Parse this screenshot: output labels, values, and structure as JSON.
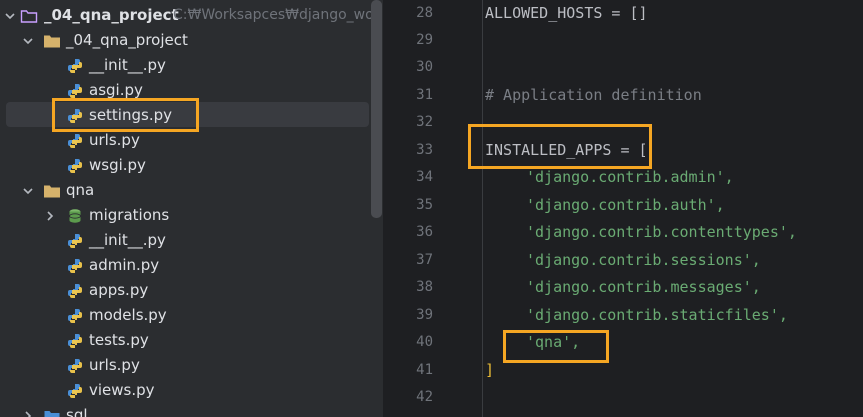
{
  "colors": {
    "accent_highlight": "#f5a623",
    "tree_bg": "#2b2d30",
    "editor_bg": "#1e1f22",
    "string": "#6aab73",
    "comment": "#7a7e85",
    "bracket": "#e8ba36"
  },
  "tree": {
    "root": {
      "label": "_04_qna_project",
      "path": "C:₩Worksapces₩django_wor",
      "icon": "module-folder-icon"
    },
    "items": [
      {
        "label": "_04_qna_project",
        "icon": "package-folder-icon",
        "expanded": true
      },
      {
        "label": "__init__.py",
        "icon": "python-file-icon"
      },
      {
        "label": "asgi.py",
        "icon": "python-file-icon"
      },
      {
        "label": "settings.py",
        "icon": "python-file-icon",
        "selected": true
      },
      {
        "label": "urls.py",
        "icon": "python-file-icon"
      },
      {
        "label": "wsgi.py",
        "icon": "python-file-icon"
      },
      {
        "label": "qna",
        "icon": "package-folder-icon",
        "expanded": true
      },
      {
        "label": "migrations",
        "icon": "database-folder-icon",
        "expanded": false
      },
      {
        "label": "__init__.py",
        "icon": "python-file-icon"
      },
      {
        "label": "admin.py",
        "icon": "python-file-icon"
      },
      {
        "label": "apps.py",
        "icon": "python-file-icon"
      },
      {
        "label": "models.py",
        "icon": "python-file-icon"
      },
      {
        "label": "tests.py",
        "icon": "python-file-icon"
      },
      {
        "label": "urls.py",
        "icon": "python-file-icon"
      },
      {
        "label": "views.py",
        "icon": "python-file-icon"
      },
      {
        "label": "sql",
        "icon": "sql-folder-icon",
        "expanded": false
      }
    ]
  },
  "editor": {
    "lines": [
      {
        "num": "28",
        "text": "ALLOWED_HOSTS = []"
      },
      {
        "num": "29",
        "text": ""
      },
      {
        "num": "30",
        "text": ""
      },
      {
        "num": "31",
        "text": "# Application definition"
      },
      {
        "num": "32",
        "text": ""
      },
      {
        "num": "33",
        "text": "INSTALLED_APPS = ["
      },
      {
        "num": "34",
        "text": "'django.contrib.admin',"
      },
      {
        "num": "35",
        "text": "'django.contrib.auth',"
      },
      {
        "num": "36",
        "text": "'django.contrib.contenttypes',"
      },
      {
        "num": "37",
        "text": "'django.contrib.sessions',"
      },
      {
        "num": "38",
        "text": "'django.contrib.messages',"
      },
      {
        "num": "39",
        "text": "'django.contrib.staticfiles',"
      },
      {
        "num": "40",
        "text": "'qna',"
      },
      {
        "num": "41",
        "text": "]"
      },
      {
        "num": "42",
        "text": ""
      }
    ]
  }
}
